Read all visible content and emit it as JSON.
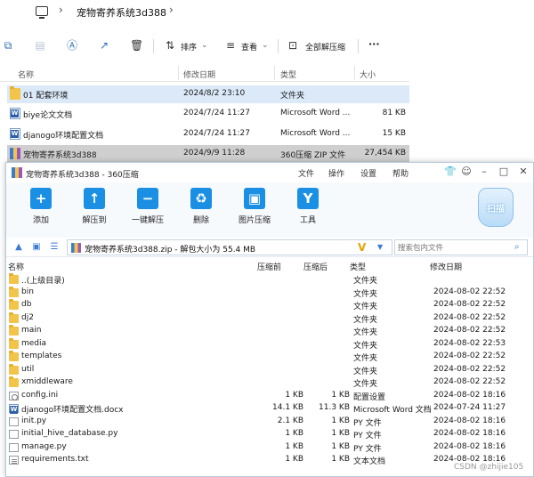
{
  "explorer": {
    "path_title": "宠物寄养系统3d388",
    "toolbar": {
      "sort_label": "排序",
      "view_label": "查看",
      "extract_all_label": "全部解压缩",
      "more_label": "···"
    },
    "columns": {
      "name": "名称",
      "date": "修改日期",
      "type": "类型",
      "size": "大小"
    },
    "rows": [
      {
        "name": "01 配套环境",
        "date": "2024/8/2 23:10",
        "type": "文件夹",
        "size": "",
        "icon": "folder-icon"
      },
      {
        "name": "biye论文文档",
        "date": "2024/7/24 11:27",
        "type": "Microsoft Word ...",
        "size": "81 KB",
        "icon": "word-doc-icon"
      },
      {
        "name": "djanogo环境配置文档",
        "date": "2024/7/24 11:27",
        "type": "Microsoft Word ...",
        "size": "15 KB",
        "icon": "word-doc-icon"
      },
      {
        "name": "宠物寄养系统3d388",
        "date": "2024/9/9 11:28",
        "type": "360压缩 ZIP 文件",
        "size": "27,454 KB",
        "icon": "zip-archive-icon"
      }
    ]
  },
  "zip": {
    "window_title": "宠物寄养系统3d388 - 360压缩",
    "menu": [
      "文件",
      "操作",
      "设置",
      "帮助"
    ],
    "tools": [
      {
        "label": "添加",
        "glyph": "+"
      },
      {
        "label": "解压到",
        "glyph": "↑"
      },
      {
        "label": "一键解压",
        "glyph": "−"
      },
      {
        "label": "删除",
        "glyph": "♻"
      },
      {
        "label": "图片压缩",
        "glyph": "▣"
      },
      {
        "label": "工具",
        "glyph": "Y"
      }
    ],
    "scan_label": "扫描",
    "address": "宠物寄养系统3d388.zip - 解包大小为 55.4 MB",
    "search_placeholder": "搜索包内文件",
    "columns": {
      "name": "名称",
      "compressed": "压缩前",
      "packed": "压缩后",
      "type": "类型",
      "date": "修改日期"
    },
    "rows": [
      {
        "name": "..(上级目录)",
        "compressed": "",
        "packed": "",
        "type": "文件夹",
        "date": "",
        "icon": "folder"
      },
      {
        "name": "bin",
        "compressed": "",
        "packed": "",
        "type": "文件夹",
        "date": "2024-08-02 22:52",
        "icon": "folder"
      },
      {
        "name": "db",
        "compressed": "",
        "packed": "",
        "type": "文件夹",
        "date": "2024-08-02 22:52",
        "icon": "folder"
      },
      {
        "name": "dj2",
        "compressed": "",
        "packed": "",
        "type": "文件夹",
        "date": "2024-08-02 22:52",
        "icon": "folder"
      },
      {
        "name": "main",
        "compressed": "",
        "packed": "",
        "type": "文件夹",
        "date": "2024-08-02 22:52",
        "icon": "folder"
      },
      {
        "name": "media",
        "compressed": "",
        "packed": "",
        "type": "文件夹",
        "date": "2024-08-02 22:53",
        "icon": "folder"
      },
      {
        "name": "templates",
        "compressed": "",
        "packed": "",
        "type": "文件夹",
        "date": "2024-08-02 22:52",
        "icon": "folder"
      },
      {
        "name": "util",
        "compressed": "",
        "packed": "",
        "type": "文件夹",
        "date": "2024-08-02 22:52",
        "icon": "folder"
      },
      {
        "name": "xmiddleware",
        "compressed": "",
        "packed": "",
        "type": "文件夹",
        "date": "2024-08-02 22:52",
        "icon": "folder"
      },
      {
        "name": "config.ini",
        "compressed": "1 KB",
        "packed": "1 KB",
        "type": "配置设置",
        "date": "2024-08-02 18:16",
        "icon": "ini"
      },
      {
        "name": "djanogo环境配置文档.docx",
        "compressed": "14.1 KB",
        "packed": "11.3 KB",
        "type": "Microsoft Word 文档",
        "date": "2024-07-24 11:27",
        "icon": "word"
      },
      {
        "name": "init.py",
        "compressed": "2.1 KB",
        "packed": "1 KB",
        "type": "PY 文件",
        "date": "2024-08-02 18:16",
        "icon": "py"
      },
      {
        "name": "initial_hive_database.py",
        "compressed": "1 KB",
        "packed": "1 KB",
        "type": "PY 文件",
        "date": "2024-08-02 18:16",
        "icon": "py"
      },
      {
        "name": "manage.py",
        "compressed": "1 KB",
        "packed": "1 KB",
        "type": "PY 文件",
        "date": "2024-08-02 18:16",
        "icon": "py"
      },
      {
        "name": "requirements.txt",
        "compressed": "1 KB",
        "packed": "1 KB",
        "type": "文本文档",
        "date": "2024-08-02 18:16",
        "icon": "txt"
      }
    ]
  },
  "watermark": "CSDN @zhijie105"
}
